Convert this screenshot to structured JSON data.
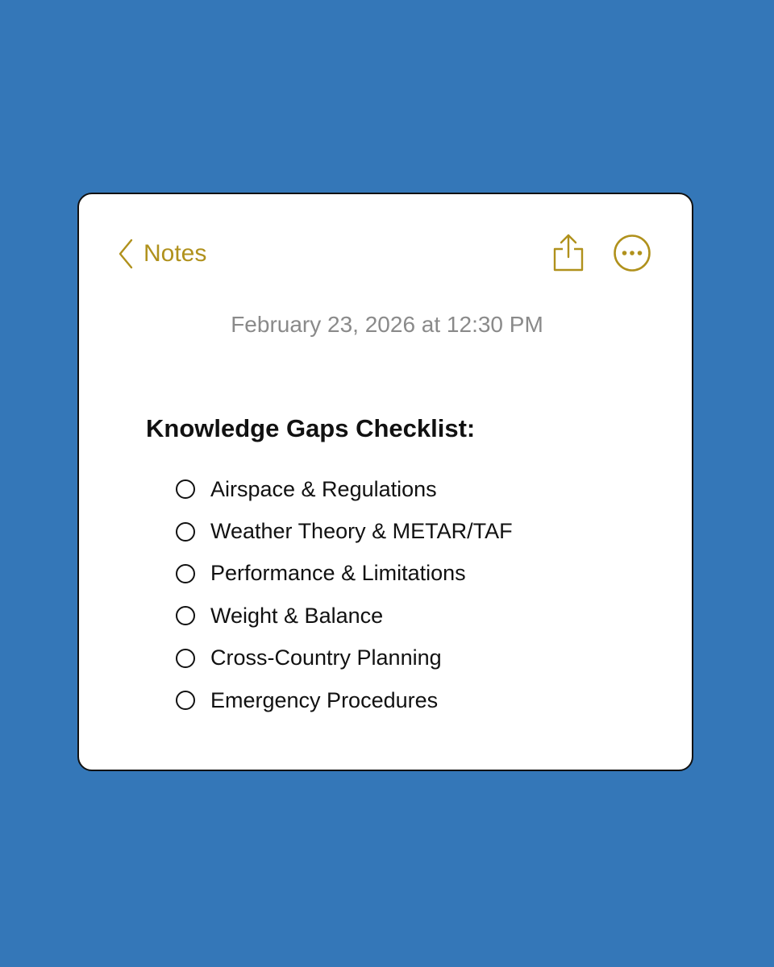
{
  "colors": {
    "background": "#3477b8",
    "card": "#ffffff",
    "accent": "#b0911c",
    "date_text": "#8a8a8a",
    "body_text": "#111111"
  },
  "nav": {
    "back_icon": "chevron-left-icon",
    "back_label": "Notes",
    "share_icon": "share-icon",
    "more_icon": "ellipsis-circle-icon"
  },
  "note": {
    "date": "February 23, 2026 at 12:30 PM",
    "title": "Knowledge Gaps Checklist:",
    "checklist": [
      {
        "label": "Airspace & Regulations",
        "checked": false
      },
      {
        "label": "Weather Theory & METAR/TAF",
        "checked": false
      },
      {
        "label": "Performance & Limitations",
        "checked": false
      },
      {
        "label": "Weight & Balance",
        "checked": false
      },
      {
        "label": "Cross-Country Planning",
        "checked": false
      },
      {
        "label": "Emergency Procedures",
        "checked": false
      }
    ]
  }
}
